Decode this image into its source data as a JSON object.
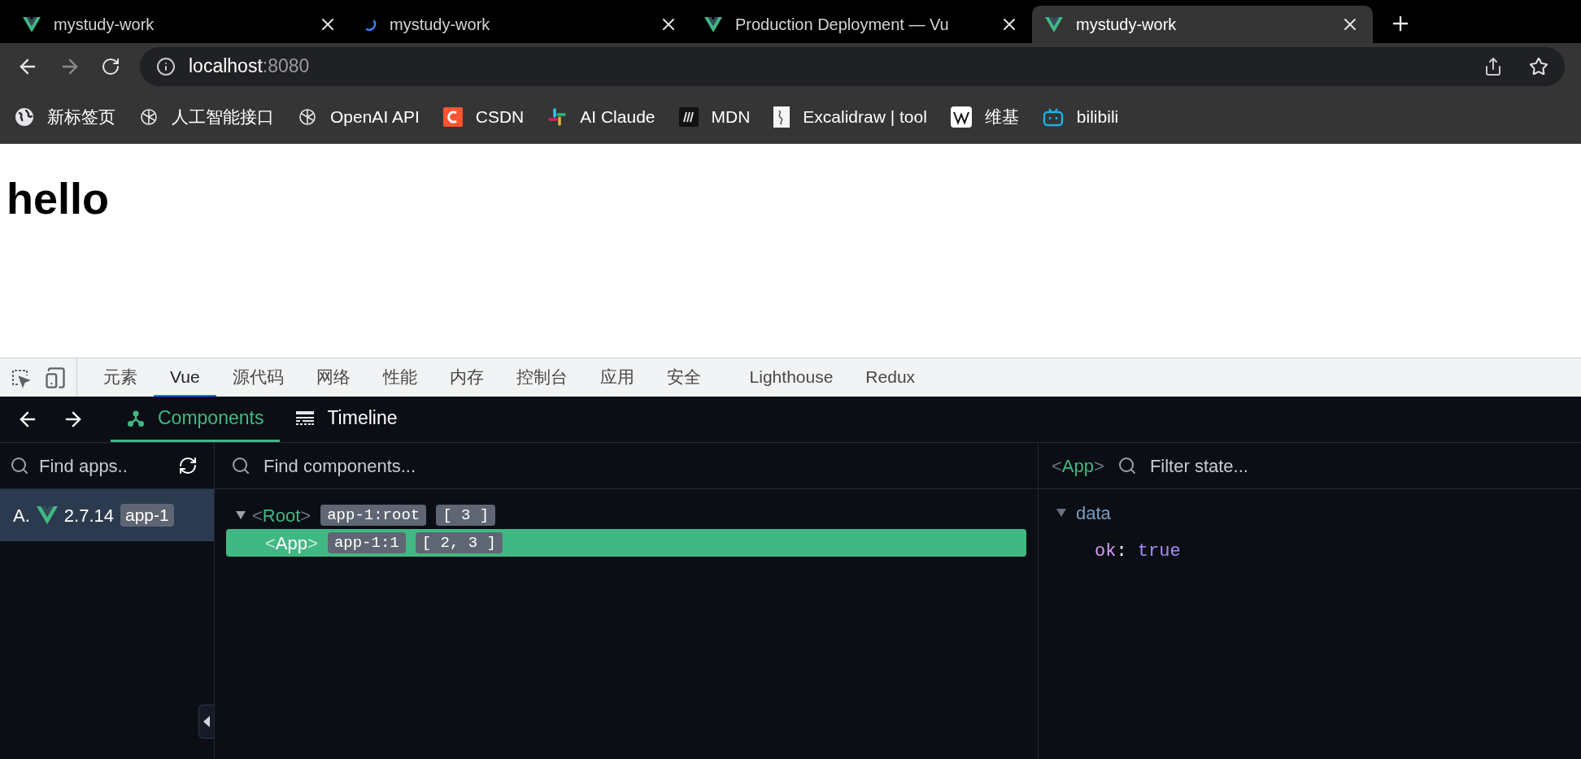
{
  "browser_tabs": [
    {
      "title": "mystudy-work",
      "kind": "vue",
      "selected": false
    },
    {
      "title": "mystudy-work",
      "kind": "loading",
      "selected": false
    },
    {
      "title": "Production Deployment — Vu",
      "kind": "vue",
      "selected": false
    },
    {
      "title": "mystudy-work",
      "kind": "vue",
      "selected": true
    }
  ],
  "address": {
    "host": "localhost",
    "port": ":8080"
  },
  "bookmarks": [
    {
      "label": "新标签页",
      "kind": "globe"
    },
    {
      "label": "人工智能接口",
      "kind": "knot"
    },
    {
      "label": "OpenAI API",
      "kind": "knot"
    },
    {
      "label": "CSDN",
      "kind": "c"
    },
    {
      "label": "AI Claude",
      "kind": "hash"
    },
    {
      "label": "MDN",
      "kind": "m"
    },
    {
      "label": "Excalidraw | tool",
      "kind": "sketch"
    },
    {
      "label": "维基",
      "kind": "w"
    },
    {
      "label": "bilibili",
      "kind": "tv"
    }
  ],
  "page": {
    "heading": "hello"
  },
  "devtools_tabs": [
    {
      "label": "元素",
      "selected": false
    },
    {
      "label": "Vue",
      "selected": true
    },
    {
      "label": "源代码",
      "selected": false
    },
    {
      "label": "网络",
      "selected": false
    },
    {
      "label": "性能",
      "selected": false
    },
    {
      "label": "内存",
      "selected": false
    },
    {
      "label": "控制台",
      "selected": false
    },
    {
      "label": "应用",
      "selected": false
    },
    {
      "label": "安全",
      "selected": false
    },
    {
      "label": "Lighthouse",
      "selected": false
    },
    {
      "label": "Redux",
      "selected": false
    }
  ],
  "vue_tabs": [
    {
      "label": "Components",
      "kind": "tree",
      "selected": true
    },
    {
      "label": "Timeline",
      "kind": "timeline",
      "selected": false
    }
  ],
  "apps_panel": {
    "placeholder": "Find apps..",
    "apps": [
      {
        "name": "A.",
        "version": "2.7.14",
        "id": "app-1",
        "selected": true
      }
    ]
  },
  "components_panel": {
    "placeholder": "Find components...",
    "tree": [
      {
        "tag": "<Root>",
        "id": "app-1:root",
        "indices": "[ 3 ]",
        "expanded": true,
        "selected": false,
        "children": [
          {
            "tag": "<App>",
            "id": "app-1:1",
            "indices": "[ 2, 3 ]",
            "selected": true
          }
        ]
      }
    ]
  },
  "inspector": {
    "component": "<App>",
    "placeholder": "Filter state...",
    "sections": [
      {
        "title": "data",
        "expanded": true,
        "entries": [
          {
            "key": "ok",
            "separator": ":",
            "value": "true"
          }
        ]
      }
    ]
  }
}
